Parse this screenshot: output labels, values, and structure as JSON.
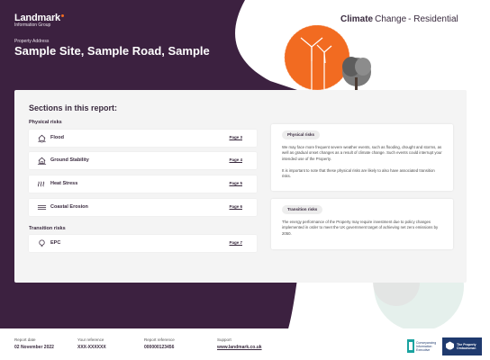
{
  "brand": {
    "name": "Landmark",
    "sub": "Information Group"
  },
  "header": {
    "title_strong": "Climate",
    "title_rest": "Change",
    "title_tail": "- Residential",
    "address_label": "Property Address",
    "address": "Sample Site, Sample Road, Sample"
  },
  "sections": {
    "title": "Sections in this report:",
    "physical_label": "Physical risks",
    "transition_label": "Transition risks",
    "physical_items": [
      {
        "label": "Flood",
        "page": "Page 3",
        "icon": "house-flood-icon"
      },
      {
        "label": "Ground Stability",
        "page": "Page 4",
        "icon": "house-ground-icon"
      },
      {
        "label": "Heat Stress",
        "page": "Page 5",
        "icon": "heat-icon"
      },
      {
        "label": "Coastal Erosion",
        "page": "Page 6",
        "icon": "waves-icon"
      }
    ],
    "transition_items": [
      {
        "label": "EPC",
        "page": "Page 7",
        "icon": "lightbulb-icon"
      }
    ]
  },
  "info": {
    "physical": {
      "pill": "Physical risks",
      "p1": "We may face more frequent severe weather events, such as flooding, drought and storms, as well as gradual onset changes as a result of climate change. Such events could interrupt your intended use of the Property.",
      "p2": "It is important to note that these physical risks are likely to also have associated transition risks."
    },
    "transition": {
      "pill": "Transition risks",
      "p1": "The energy performance of the Property may require investment due to policy changes implemented in order to meet the UK government target of achieving net zero emissions by 2050."
    }
  },
  "footer": {
    "report_date_label": "Report date",
    "report_date": "02 November 2022",
    "your_ref_label": "Your reference",
    "your_ref": "XXX-XXXXXX",
    "report_ref_label": "Report reference",
    "report_ref": "000000123456",
    "support_label": "Support",
    "support": "www.landmark.co.uk",
    "badge1": [
      "Conveyancing",
      "Information",
      "Executive"
    ],
    "badge2": [
      "The Property",
      "Ombudsman"
    ]
  },
  "colors": {
    "dark_purple": "#3c2140",
    "orange": "#f26b21",
    "teal": "#cfe3dd"
  }
}
